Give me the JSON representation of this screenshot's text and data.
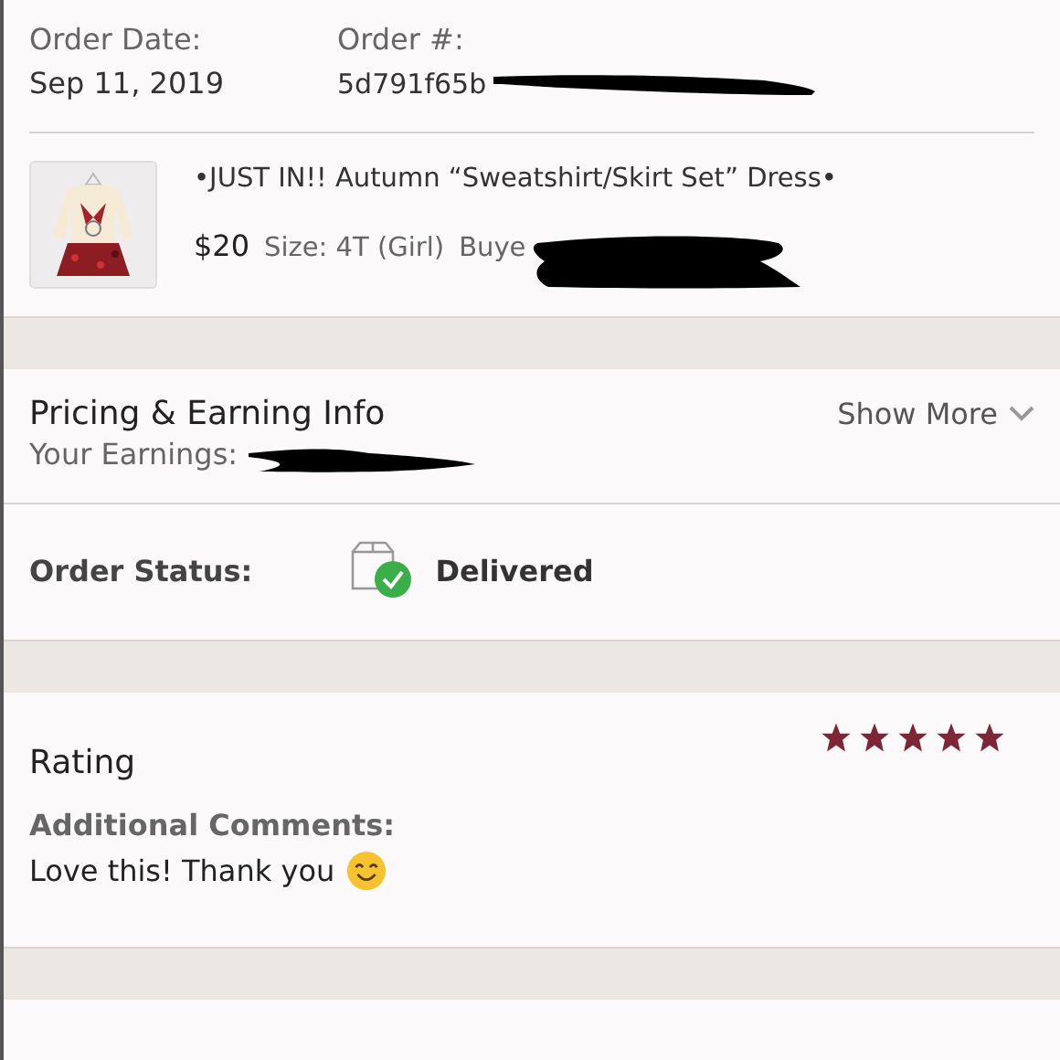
{
  "order": {
    "date_label": "Order Date:",
    "date": "Sep 11, 2019",
    "number_label": "Order #:",
    "number": "5d791f65b",
    "number_redacted": true
  },
  "item": {
    "title": "•JUST IN!! Autumn “Sweatshirt/Skirt Set” Dress•",
    "price": "$20",
    "size": "Size: 4T (Girl)",
    "buyer": "Buye",
    "buyer_redacted": true
  },
  "pricing": {
    "title": "Pricing & Earning Info",
    "toggle": "Show More",
    "expanded": false,
    "earnings": "Your Earnings:",
    "earnings_redacted": true
  },
  "status": {
    "label": "Order Status:",
    "value": "Delivered",
    "delivered": true
  },
  "rating": {
    "title": "Rating",
    "stars": 5,
    "comments_label": "Additional Comments:",
    "comment": "Love this! Thank you"
  }
}
